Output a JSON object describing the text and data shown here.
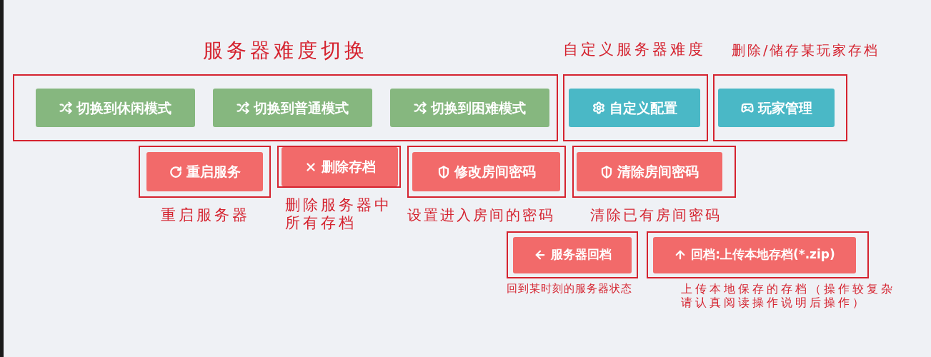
{
  "rows": [
    {
      "groups": [
        {
          "note": "服务器难度切换",
          "buttons": [
            {
              "label": "切换到休闲模式",
              "color": "#86b77f"
            },
            {
              "label": "切换到普通模式",
              "color": "#86b77f"
            },
            {
              "label": "切换到困难模式",
              "color": "#86b77f"
            }
          ]
        },
        {
          "note": "自定义服务器难度",
          "buttons": [
            {
              "label": "自定义配置",
              "color": "#4ab8c6"
            }
          ]
        },
        {
          "note": "删除/储存某玩家存档",
          "buttons": [
            {
              "label": "玩家管理",
              "color": "#4ab8c6"
            }
          ]
        }
      ]
    },
    {
      "groups": [
        {
          "note": "重启服务器",
          "buttons": [
            {
              "label": "重启服务",
              "color": "#f26a6a"
            }
          ]
        },
        {
          "note": "删除服务器中所有存档",
          "buttons": [
            {
              "label": "删除存档",
              "color": "#f26a6a"
            }
          ]
        },
        {
          "note": "设置进入房间的密码",
          "buttons": [
            {
              "label": "修改房间密码",
              "color": "#f26a6a"
            }
          ]
        },
        {
          "note": "清除已有房间密码",
          "buttons": [
            {
              "label": "清除房间密码",
              "color": "#f26a6a"
            }
          ]
        }
      ]
    },
    {
      "groups": [
        {
          "note": "回到某时刻的服务器状态",
          "buttons": [
            {
              "label": "服务器回档",
              "color": "#f26a6a"
            }
          ]
        },
        {
          "note": "上传本地保存的存档（操作较复杂请认真阅读操作说明后操作）",
          "buttons": [
            {
              "label": "回档:上传本地存档(*.zip)",
              "color": "#f26a6a"
            }
          ]
        }
      ]
    }
  ]
}
